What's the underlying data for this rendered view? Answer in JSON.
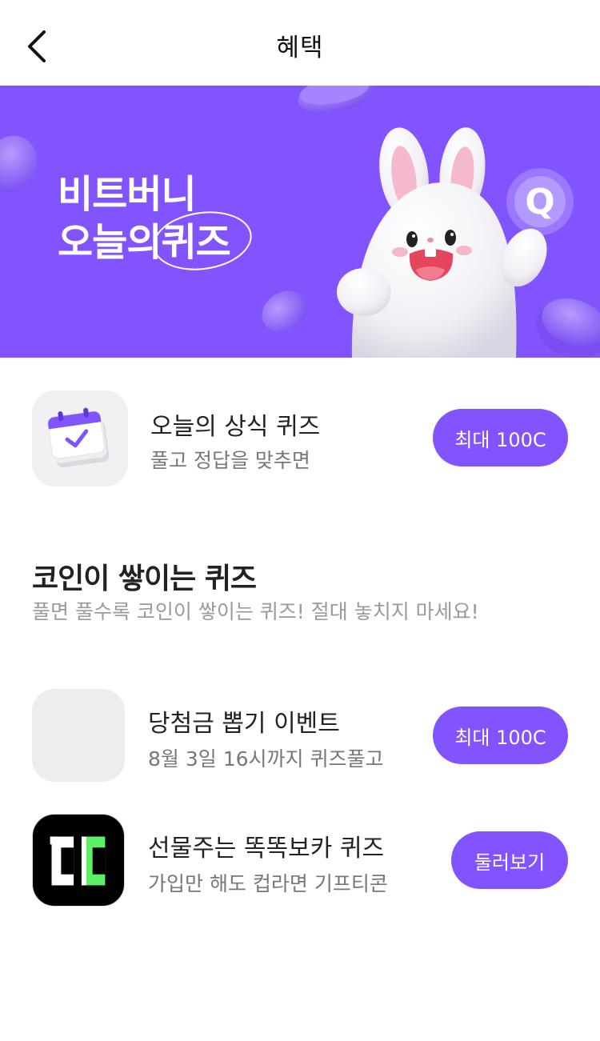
{
  "header": {
    "title": "혜택"
  },
  "banner": {
    "title_line1": "비트버니",
    "title_line2_prefix": "오늘의",
    "title_line2_circled": "퀴즈",
    "badge_letter": "Q",
    "background_color": "#8154FF"
  },
  "daily_quiz": {
    "title": "오늘의 상식 퀴즈",
    "subtitle": "풀고 정답을 맞추면",
    "button_label": "최대 100C",
    "icon": "calendar-check-icon"
  },
  "section": {
    "title": "코인이 쌓이는 퀴즈",
    "subtitle": "풀면 풀수록 코인이 쌓이는 퀴즈! 절대 놓치지 마세요!"
  },
  "quizzes": [
    {
      "title": "당첨금 뽑기 이벤트",
      "subtitle": "8월 3일 16시까지 퀴즈풀고",
      "button_label": "최대 100C",
      "icon": "placeholder-thumbnail"
    },
    {
      "title": "선물주는 똑똑보카 퀴즈",
      "subtitle": "가입만 해도 컵라면 기프티콘",
      "button_label": "둘러보기",
      "icon": "ddokddok-voca-logo-icon"
    }
  ],
  "colors": {
    "accent": "#8154FF",
    "thumb_bg": "#F1F1F4",
    "logo_green": "#5CF065"
  }
}
